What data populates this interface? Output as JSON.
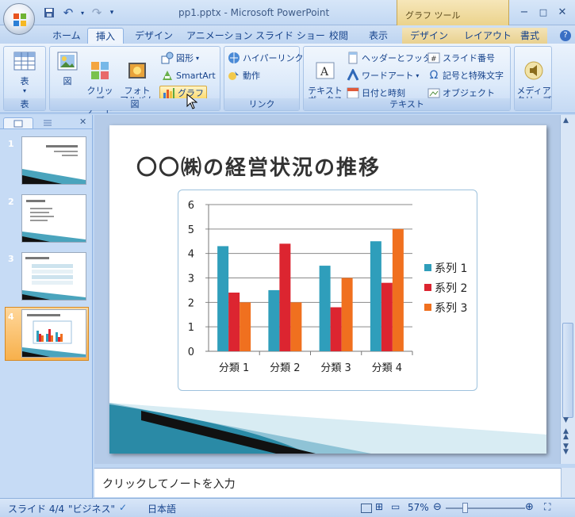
{
  "window": {
    "doc_title": "pp1.pptx - Microsoft PowerPoint",
    "context_tool_label": "グラフ ツール",
    "minimize": "−",
    "restore": "□",
    "close": "✕"
  },
  "qat": {
    "save": "💾",
    "undo": "↶",
    "redo": "↷",
    "more": "▾"
  },
  "tabs": [
    {
      "label": "ホーム"
    },
    {
      "label": "挿入"
    },
    {
      "label": "デザイン"
    },
    {
      "label": "アニメーション"
    },
    {
      "label": "スライド ショー"
    },
    {
      "label": "校閲"
    },
    {
      "label": "表示"
    },
    {
      "label": "デザイン"
    },
    {
      "label": "レイアウト"
    },
    {
      "label": "書式"
    }
  ],
  "ribbon": {
    "groups": {
      "table": "表",
      "illustrations": "図",
      "links": "リンク",
      "text": "テキスト"
    },
    "buttons": {
      "table": "表",
      "picture": "図",
      "clipart": "クリップ\nアート",
      "photo_album": "フォト\nアルバム",
      "shapes": "図形",
      "smartart": "SmartArt",
      "chart": "グラフ",
      "hyperlink": "ハイパーリンク",
      "action": "動作",
      "textbox": "テキスト\nボックス",
      "header_footer": "ヘッダーとフッター",
      "wordart": "ワードアート",
      "datetime": "日付と時刻",
      "slide_number": "スライド番号",
      "symbol": "記号と特殊文字",
      "object": "オブジェクト",
      "media_clip": "メディア\nクリップ"
    }
  },
  "slides_pane": {
    "numbers": [
      "1",
      "2",
      "3",
      "4"
    ],
    "selected": 4
  },
  "slide": {
    "title": "〇〇㈱の経営状況の推移"
  },
  "chart_data": {
    "type": "bar",
    "categories": [
      "分類 1",
      "分類 2",
      "分類 3",
      "分類 4"
    ],
    "series": [
      {
        "name": "系列 1",
        "values": [
          4.3,
          2.5,
          3.5,
          4.5
        ],
        "color": "#2f9ebb"
      },
      {
        "name": "系列 2",
        "values": [
          2.4,
          4.4,
          1.8,
          2.8
        ],
        "color": "#dc2530"
      },
      {
        "name": "系列 3",
        "values": [
          2.0,
          2.0,
          3.0,
          5.0
        ],
        "color": "#f0701f"
      }
    ],
    "ylim": [
      0,
      6
    ],
    "yticks": [
      "0",
      "1",
      "2",
      "3",
      "4",
      "5",
      "6"
    ],
    "grid": true,
    "legend": "right"
  },
  "notes": {
    "placeholder": "クリックしてノートを入力"
  },
  "status": {
    "slide": "スライド 4/4",
    "theme": "\"ビジネス\"",
    "language": "日本語",
    "zoom": "57%"
  }
}
